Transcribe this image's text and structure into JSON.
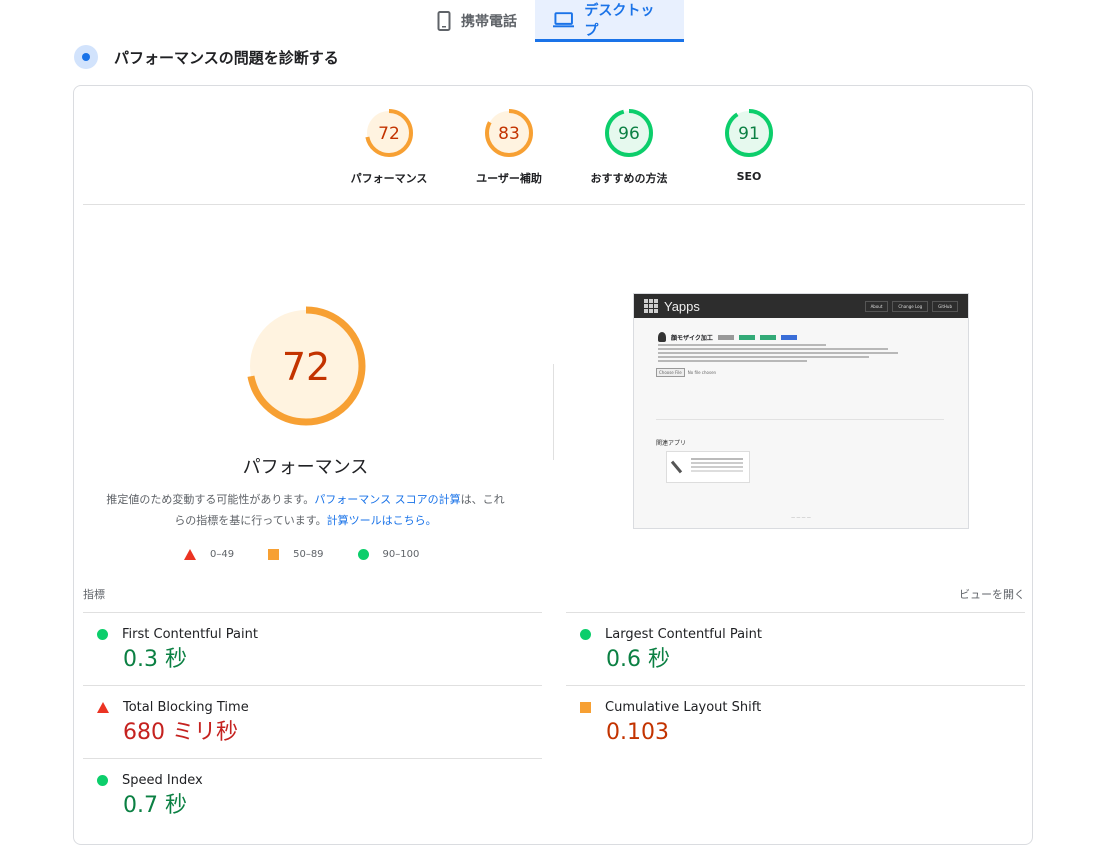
{
  "device_tabs": [
    {
      "label": "携帯電話",
      "icon": "smartphone-icon",
      "active": false
    },
    {
      "label": "デスクトップ",
      "icon": "laptop-icon",
      "active": true
    }
  ],
  "diagnose": {
    "title": "パフォーマンスの問題を診断する",
    "icon": "diagnose-icon"
  },
  "scores": [
    {
      "value": "72",
      "label": "パフォーマンス",
      "fraction": 0.72,
      "color": "#f7a033",
      "text_color": "#c33300",
      "fill": "#fff3e0"
    },
    {
      "value": "83",
      "label": "ユーザー補助",
      "fraction": 0.83,
      "color": "#f7a033",
      "text_color": "#c33300",
      "fill": "#fff3e0"
    },
    {
      "value": "96",
      "label": "おすすめの方法",
      "fraction": 0.96,
      "color": "#0cce6b",
      "text_color": "#0b8043",
      "fill": "#e6f9ee"
    },
    {
      "value": "91",
      "label": "SEO",
      "fraction": 0.91,
      "color": "#0cce6b",
      "text_color": "#0b8043",
      "fill": "#e6f9ee"
    }
  ],
  "main_score": {
    "value": "72",
    "fraction": 0.72,
    "label": "パフォーマンス",
    "desc_part1": "推定値のため変動する可能性があります。",
    "desc_link1": "パフォーマンス スコアの計算",
    "desc_part2": "は、これらの指標を基に行っています。",
    "desc_link2": "計算ツールはこちら。"
  },
  "legend": [
    {
      "shape": "triangle",
      "range": "0–49",
      "color": "#eb3323"
    },
    {
      "shape": "square",
      "range": "50–89",
      "color": "#f7a033"
    },
    {
      "shape": "circle",
      "range": "90–100",
      "color": "#0cce6b"
    }
  ],
  "preview": {
    "brand": "Yapps",
    "nav_links": [
      "About",
      "Change Log",
      "GitHub"
    ],
    "app_title": "顔モザイク加工",
    "choose_button": "Choose File",
    "choose_text": "No file chosen",
    "related_heading": "関連アプリ"
  },
  "metrics_section": {
    "title": "指標",
    "toggle": "ビューを開く"
  },
  "metrics": [
    {
      "name": "First Contentful Paint",
      "value": "0.3 秒",
      "status": "good"
    },
    {
      "name": "Largest Contentful Paint",
      "value": "0.6 秒",
      "status": "good"
    },
    {
      "name": "Total Blocking Time",
      "value": "680 ミリ秒",
      "status": "poor"
    },
    {
      "name": "Cumulative Layout Shift",
      "value": "0.103",
      "status": "average"
    },
    {
      "name": "Speed Index",
      "value": "0.7 秒",
      "status": "good"
    }
  ]
}
